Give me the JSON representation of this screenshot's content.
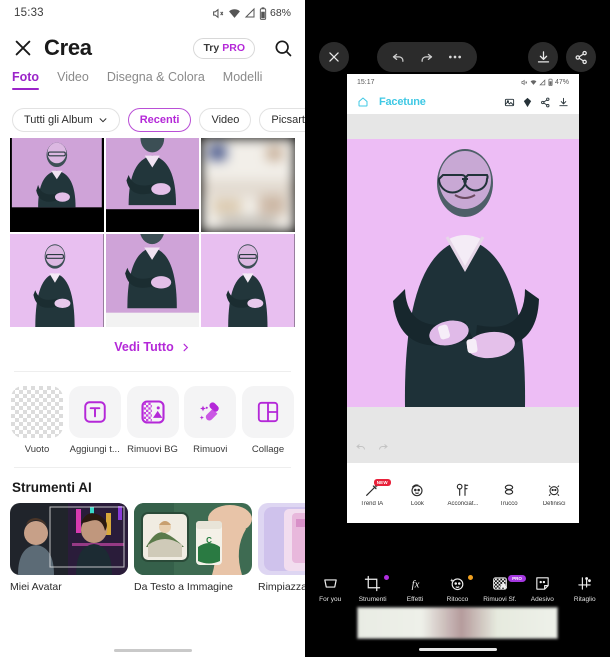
{
  "left": {
    "status": {
      "time": "15:33",
      "battery": "68%",
      "icons": [
        "mute-icon",
        "wifi-icon",
        "signal-icon",
        "battery-icon"
      ]
    },
    "appbar": {
      "close_icon": "close-icon",
      "title": "Crea",
      "try_pro": {
        "prefix": "Try",
        "label": "PRO"
      },
      "search_icon": "search-icon"
    },
    "tabs": [
      {
        "label": "Foto",
        "active": true
      },
      {
        "label": "Video",
        "active": false
      },
      {
        "label": "Disegna & Colora",
        "active": false
      },
      {
        "label": "Modelli",
        "active": false
      }
    ],
    "chips": [
      {
        "label": "Tutti gli Album",
        "dropdown": true,
        "selected": false
      },
      {
        "label": "Recenti",
        "dropdown": false,
        "selected": true
      },
      {
        "label": "Video",
        "dropdown": false,
        "selected": false
      },
      {
        "label": "Picsart",
        "dropdown": false,
        "selected": false
      }
    ],
    "gallery": [
      {
        "name": "photo-letterboxed-1",
        "kind": "letterbox"
      },
      {
        "name": "photo-letterboxed-2",
        "kind": "letterbox-crop"
      },
      {
        "name": "photo-blurred",
        "kind": "blur"
      },
      {
        "name": "photo-full-1",
        "kind": "full"
      },
      {
        "name": "photo-crop-2",
        "kind": "crop-bottom"
      },
      {
        "name": "photo-full-3",
        "kind": "full"
      }
    ],
    "see_all": {
      "label": "Vedi Tutto",
      "chevron": "chevron-right-icon"
    },
    "quick_tools": [
      {
        "label": "Vuoto",
        "icon": "empty-canvas-icon"
      },
      {
        "label": "Aggiungi t...",
        "icon": "add-text-icon"
      },
      {
        "label": "Rimuovi BG",
        "icon": "remove-background-icon"
      },
      {
        "label": "Rimuovi",
        "icon": "magic-eraser-icon"
      },
      {
        "label": "Collage",
        "icon": "collage-icon"
      }
    ],
    "ai_section": {
      "title": "Strumenti AI",
      "cards": [
        {
          "label": "Miei Avatar",
          "icon": "avatar-card"
        },
        {
          "label": "Da Testo a Immagine",
          "icon": "text-to-image-card"
        },
        {
          "label": "Rimpiazza",
          "icon": "replace-card"
        }
      ]
    }
  },
  "right": {
    "toolbar": {
      "close_icon": "close-icon",
      "undo_icon": "undo-icon",
      "redo_icon": "redo-icon",
      "more_icon": "more-options-icon",
      "download_icon": "download-icon",
      "share_icon": "share-icon"
    },
    "phone": {
      "status": {
        "time": "15:17",
        "battery": "47%",
        "icons": [
          "mute-icon",
          "wifi-icon",
          "signal-icon",
          "battery-icon"
        ]
      },
      "appbar": {
        "home_icon": "home-icon",
        "title": "Facetune",
        "actions": [
          "gallery-icon",
          "pro-diamond-icon",
          "share-icon",
          "download-icon"
        ]
      },
      "tools": [
        {
          "label": "Trend IA",
          "icon": "magic-wand-icon",
          "badge": "NEW"
        },
        {
          "label": "Look",
          "icon": "face-look-icon",
          "badge": ""
        },
        {
          "label": "Acconciat...",
          "icon": "hair-icon",
          "badge": ""
        },
        {
          "label": "Trucco",
          "icon": "makeup-icon",
          "badge": ""
        },
        {
          "label": "Definisci",
          "icon": "refine-icon",
          "badge": ""
        }
      ]
    },
    "bottombar": [
      {
        "label": "For you",
        "icon": "foryou-icon",
        "dot": "",
        "pro": false
      },
      {
        "label": "Strumenti",
        "icon": "tools-crop-icon",
        "dot": "#b02ee0",
        "pro": false
      },
      {
        "label": "Effetti",
        "icon": "effects-fx-icon",
        "dot": "",
        "pro": false
      },
      {
        "label": "Ritocco",
        "icon": "retouch-icon",
        "dot": "#f0a020",
        "pro": false
      },
      {
        "label": "Rimuovi Sf.",
        "icon": "remove-bg-icon",
        "dot": "",
        "pro": true,
        "pro_label": "PRO"
      },
      {
        "label": "Adesivo",
        "icon": "sticker-icon",
        "dot": "",
        "pro": false
      },
      {
        "label": "Ritaglio",
        "icon": "crop-icon",
        "dot": "",
        "pro": false
      }
    ]
  }
}
